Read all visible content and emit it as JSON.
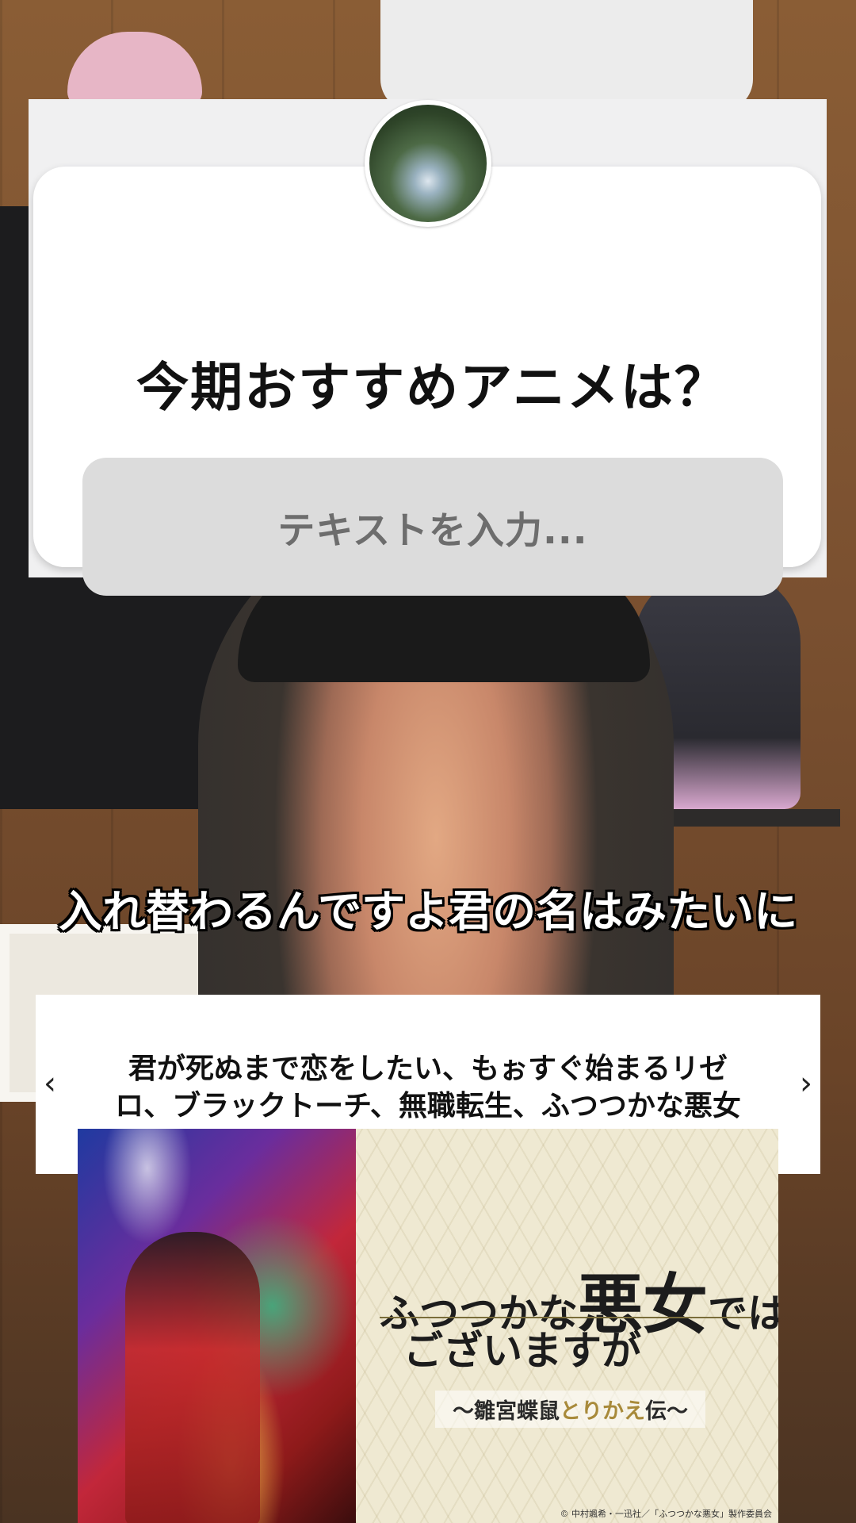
{
  "question_sticker": {
    "title": "今期おすすめアニメは？",
    "answer_placeholder": "テキストを入力..."
  },
  "subtitle": "入れ替わるんですよ君の名はみたいに",
  "caption_banner": {
    "line1": "君が死ぬまで恋をしたい、もぉすぐ始まるリゼ",
    "line2": "ロ、ブラックトーチ、無職転生、ふつつかな悪女",
    "prev_icon": "‹",
    "next_icon": "›"
  },
  "poster": {
    "title_part1": "ふつつかな",
    "title_big": "悪女",
    "title_part2": "では",
    "title_line2": "ございますが",
    "subtitle_pre": "〜雛宮蝶鼠",
    "subtitle_accent": "とりかえ",
    "subtitle_post": "伝〜",
    "credit": "© 中村颯希・一迅社／「ふつつかな悪女」製作委員会"
  }
}
